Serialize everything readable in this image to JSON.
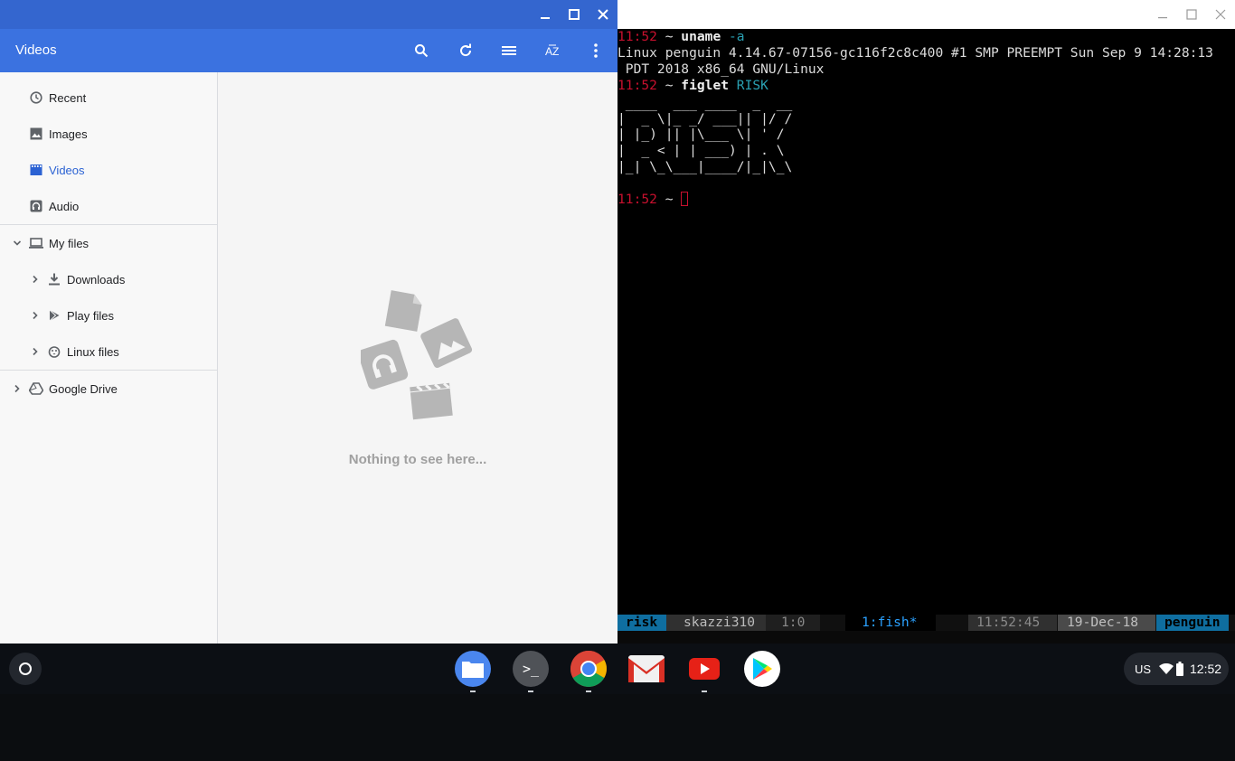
{
  "files_app": {
    "title": "Videos",
    "toolbar": [
      "search-icon",
      "refresh-icon",
      "list-view-icon",
      "sort-icon",
      "more-vert-icon"
    ],
    "nav": [
      {
        "label": "Recent",
        "icon": "clock-icon"
      },
      {
        "label": "Images",
        "icon": "image-icon"
      },
      {
        "label": "Videos",
        "icon": "film-icon",
        "active": true
      },
      {
        "label": "Audio",
        "icon": "headphones-icon"
      },
      {
        "label": "My files",
        "icon": "laptop-icon",
        "expanded": true
      },
      {
        "label": "Downloads",
        "icon": "download-icon"
      },
      {
        "label": "Play files",
        "icon": "play-store-icon"
      },
      {
        "label": "Linux files",
        "icon": "penguin-icon"
      },
      {
        "label": "Google Drive",
        "icon": "drive-icon"
      }
    ],
    "empty_message": "Nothing to see here..."
  },
  "terminal": {
    "lines": [
      {
        "time": "11:52",
        "prompt": " ~ ",
        "cmd": "uname",
        "arg": " -a"
      },
      {
        "text": "Linux penguin 4.14.67-07156-gc116f2c8c400 #1 SMP PREEMPT Sun Sep 9 14:28:13"
      },
      {
        "text": " PDT 2018 x86_64 GNU/Linux"
      },
      {
        "time": "11:52",
        "prompt": " ~ ",
        "cmd": "figlet",
        "arg": " RISK"
      },
      {
        "text": " ____  ___ ____  _  __"
      },
      {
        "text": "|  _ \\|_ _/ ___|| |/ /"
      },
      {
        "text": "| |_) || |\\___ \\| ' /"
      },
      {
        "text": "|  _ < | | ___) | . \\"
      },
      {
        "text": "|_| \\_\\___|____/|_|\\_\\"
      },
      {
        "time": "11:52",
        "prompt": " ~ "
      }
    ],
    "status": {
      "session": "risk",
      "user": "skazzi310",
      "pane": "1:0",
      "window": "1:fish*",
      "clock": "11:52:45",
      "date": "19-Dec-18",
      "host": "penguin"
    }
  },
  "shelf": {
    "apps": [
      "files-app-icon",
      "terminal-app-icon",
      "chrome-app-icon",
      "gmail-app-icon",
      "youtube-app-icon",
      "play-store-app-icon"
    ],
    "terminal_glyph": ">_",
    "tray": {
      "lang": "US",
      "time": "12:52"
    }
  },
  "colors": {
    "accent": "#3b72e0",
    "prompt_red": "#c8102e",
    "arg_cyan": "#2aa1b3",
    "tmux_blue": "#0f6ea0"
  }
}
